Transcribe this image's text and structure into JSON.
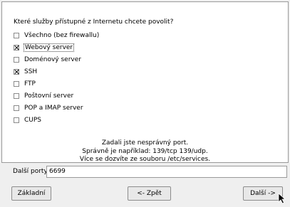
{
  "wizard": {
    "question": "Které služby přístupné z Internetu chcete povolit?",
    "services": [
      {
        "label": "Všechno (bez firewallu)",
        "checked": false,
        "focused": false
      },
      {
        "label": "Webový server",
        "checked": true,
        "focused": true
      },
      {
        "label": "Doménový server",
        "checked": false,
        "focused": false
      },
      {
        "label": "SSH",
        "checked": true,
        "focused": false
      },
      {
        "label": "FTP",
        "checked": false,
        "focused": false
      },
      {
        "label": "Poštovní server",
        "checked": false,
        "focused": false
      },
      {
        "label": "POP a IMAP server",
        "checked": false,
        "focused": false
      },
      {
        "label": "CUPS",
        "checked": false,
        "focused": false
      }
    ],
    "message": {
      "line1": "Zadali jste nesprávný port.",
      "line2": "Správně je například: 139/tcp 139/udp.",
      "line3": "Více se dozvíte ze souboru /etc/services."
    },
    "ports": {
      "label": "Další porty",
      "value": "6699"
    },
    "buttons": {
      "basic": "Základní",
      "back": "<- Zpět",
      "next": "Další ->"
    }
  },
  "icons": {
    "cursor": "arrow-cursor-icon"
  }
}
